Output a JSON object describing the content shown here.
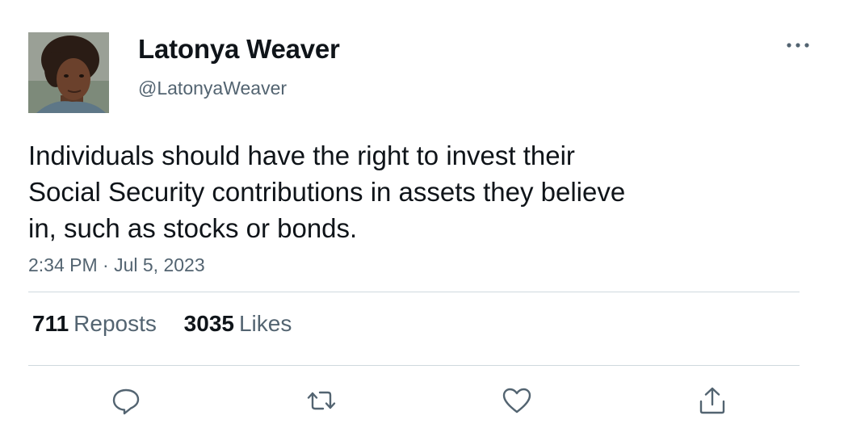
{
  "tweet": {
    "author": {
      "display_name": "Latonya Weaver",
      "handle": "@LatonyaWeaver"
    },
    "text_lines": [
      "Individuals should have the right to invest their",
      "Social Security contributions in assets they believe",
      "in, such as stocks or bonds."
    ],
    "timestamp": "2:34 PM · Jul 5, 2023",
    "stats": {
      "reposts_count": "711",
      "reposts_label": "Reposts",
      "likes_count": "3035",
      "likes_label": "Likes"
    },
    "actions": [
      "reply-icon",
      "repost-icon",
      "like-icon",
      "share-icon"
    ]
  },
  "colors": {
    "text_primary": "#0f1419",
    "text_secondary": "#536471",
    "divider": "#cfd9de",
    "icon": "#536471"
  }
}
